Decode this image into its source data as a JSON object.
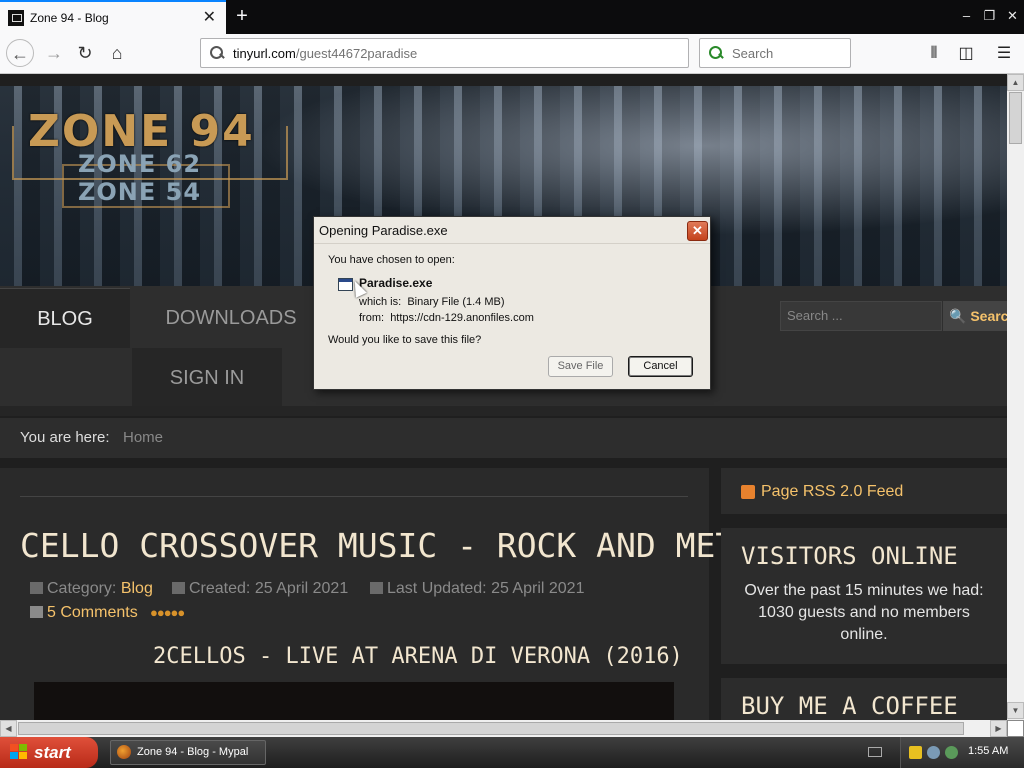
{
  "browser": {
    "tab_title": "Zone 94 - Blog",
    "url_host": "tinyurl.com",
    "url_path": "/guest44672paradise",
    "search_placeholder": "Search"
  },
  "hero": {
    "logo": "ZONE 94",
    "sub1": "ZONE 62",
    "sub2": "ZONE 54"
  },
  "menu": {
    "blog": "BLOG",
    "downloads": "DOWNLOADS",
    "signin": "SIGN IN",
    "search_placeholder": "Search ...",
    "search_button": "Searc"
  },
  "breadcrumb": {
    "label": "You are here:",
    "home": "Home"
  },
  "article": {
    "title": "CELLO CROSSOVER MUSIC - ROCK AND METAL",
    "category_label": "Category:",
    "category": "Blog",
    "created": "Created: 25 April 2021",
    "updated": "Last Updated: 25 April 2021",
    "comments": "5 Comments",
    "rating_stars": 5,
    "video_title": "2CELLOS - LIVE AT ARENA DI VERONA (2016)"
  },
  "sidebar": {
    "rss": "Page RSS 2.0 Feed",
    "visitors_title": "VISITORS ONLINE",
    "visitors_text": "Over the past 15 minutes we had: 1030 guests and no members online.",
    "coffee_title": "BUY ME A COFFEE"
  },
  "dialog": {
    "title": "Opening Paradise.exe",
    "chosen": "You have chosen to open:",
    "filename": "Paradise.exe",
    "which_label": "which is:",
    "which_value": "Binary File (1.4 MB)",
    "from_label": "from:",
    "from_value": "https://cdn-129.anonfiles.com",
    "question": "Would you like to save this file?",
    "save": "Save File",
    "cancel": "Cancel"
  },
  "taskbar": {
    "start": "start",
    "task": "Zone 94 - Blog - Mypal",
    "clock": "1:55 AM"
  },
  "colors": {
    "accent_gold": "#f5c26b",
    "title_cream": "#f2e6cf",
    "start_red": "#c83a22"
  }
}
